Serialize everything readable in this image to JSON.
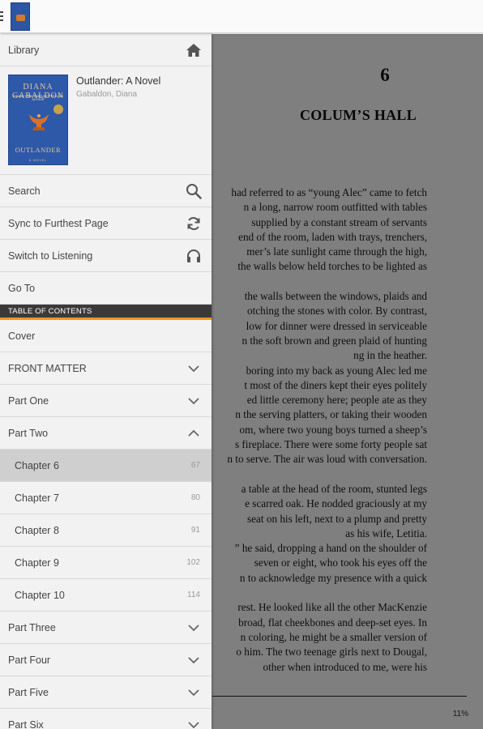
{
  "library": {
    "label": "Library"
  },
  "book": {
    "title": "Outlander: A Novel",
    "author": "Gabaldon, Diana",
    "cover": {
      "author": "DIANA GABALDON",
      "tagline": "#1 NEW YORK TIMES BESTSELLING AUTHOR",
      "title": "OUTLANDER",
      "footer": "A NOVEL",
      "color": "#2e58a8"
    }
  },
  "menu": {
    "search": "Search",
    "sync": "Sync to Furthest Page",
    "listen": "Switch to Listening",
    "goto": "Go To"
  },
  "toc": {
    "header": "TABLE OF CONTENTS",
    "accent": "#f7941d",
    "items": [
      {
        "label": "Cover"
      },
      {
        "label": "FRONT MATTER"
      },
      {
        "label": "Part One"
      },
      {
        "label": "Part Two"
      }
    ],
    "chapters": [
      {
        "label": "Chapter 6",
        "page": "67"
      },
      {
        "label": "Chapter 7",
        "page": "80"
      },
      {
        "label": "Chapter 8",
        "page": "91"
      },
      {
        "label": "Chapter 9",
        "page": "102"
      },
      {
        "label": "Chapter 10",
        "page": "114"
      }
    ],
    "parts_after": [
      {
        "label": "Part Three"
      },
      {
        "label": "Part Four"
      },
      {
        "label": "Part Five"
      },
      {
        "label": "Part Six"
      }
    ]
  },
  "reader": {
    "chapter_number": "6",
    "chapter_title": "COLUM’S HALL",
    "lines": [
      "had referred to as “young Alec” came to fetch",
      "n a long, narrow room outfitted with tables",
      "supplied by a constant stream of servants",
      "end of the room, laden with trays, trenchers,",
      "mer’s late sunlight came through the high,",
      "the walls below held torches to be lighted as",
      "",
      "the walls between the windows, plaids and",
      "otching the stones with color. By contrast,",
      "low for dinner were dressed in serviceable",
      "n the soft brown and green plaid of hunting",
      "ng in the heather.",
      "boring into my back as young Alec led me",
      "t most of the diners kept their eyes politely",
      "ed little ceremony here; people ate as they",
      "n the serving platters, or taking their wooden",
      "om, where two young boys turned a sheep’s",
      "s fireplace. There were some forty people sat",
      "n to serve. The air was loud with conversation.",
      "",
      "a table at the head of the room, stunted legs",
      "e scarred oak. He nodded graciously at my",
      "seat on his left, next to a plump and pretty",
      "as his wife, Letitia.",
      "” he said, dropping a hand on the shoulder of",
      "seven or eight, who took his eyes off the",
      "n to acknowledge my presence with a quick",
      "",
      "rest. He looked like all the other MacKenzie",
      "broad, flat cheekbones and deep-set eyes. In",
      "n coloring, he might be a smaller version of",
      "o him. The two teenage girls next to Dougal,",
      "other when introduced to me, were his"
    ],
    "progress": "11%"
  }
}
